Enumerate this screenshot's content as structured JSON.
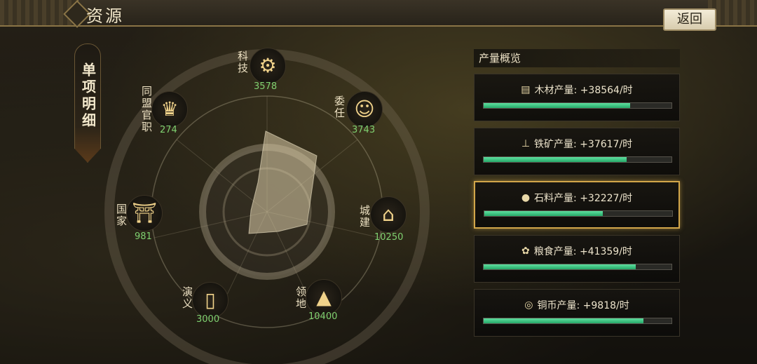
{
  "header": {
    "title": "资源",
    "back_label": "返回"
  },
  "side_tab": {
    "label": "单项明细"
  },
  "radar": {
    "nodes": [
      {
        "key": "tech",
        "label": "科技",
        "value": "3578",
        "icon": "gear-target-icon"
      },
      {
        "key": "appoint",
        "label": "委任",
        "value": "3743",
        "icon": "official-portrait-icon"
      },
      {
        "key": "city",
        "label": "城建",
        "value": "10250",
        "icon": "building-icon"
      },
      {
        "key": "territory",
        "label": "领地",
        "value": "10400",
        "icon": "mountain-icon"
      },
      {
        "key": "story",
        "label": "演义",
        "value": "3000",
        "icon": "scroll-icon"
      },
      {
        "key": "nation",
        "label": "国家",
        "value": "981",
        "icon": "palace-icon"
      },
      {
        "key": "alliance",
        "label": "同盟官职",
        "value": "274",
        "icon": "alliance-badge-icon"
      }
    ]
  },
  "production": {
    "title": "产量概览",
    "items": [
      {
        "label": "木材产量: +38564/时",
        "icon": "wood-icon",
        "fill": 0.78,
        "selected": false
      },
      {
        "label": "铁矿产量: +37617/时",
        "icon": "anvil-icon",
        "fill": 0.76,
        "selected": false
      },
      {
        "label": "石料产量: +32227/时",
        "icon": "stone-icon",
        "fill": 0.63,
        "selected": true
      },
      {
        "label": "粮食产量: +41359/时",
        "icon": "grain-icon",
        "fill": 0.81,
        "selected": false
      },
      {
        "label": "铜币产量: +9818/时",
        "icon": "coin-icon",
        "fill": 0.85,
        "selected": false
      }
    ]
  },
  "colors": {
    "accent_gold": "#d2a64a",
    "value_green": "#7fd070",
    "bar_green": "#3fc585"
  }
}
